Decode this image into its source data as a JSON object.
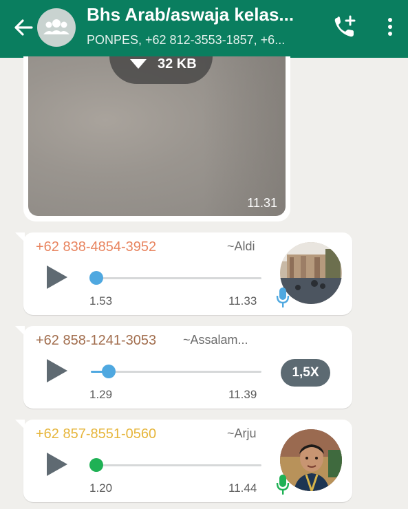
{
  "header": {
    "title": "Bhs Arab/aswaja kelas...",
    "subtitle": "PONPES, +62 812-3553-1857, +6...",
    "bg_color": "#0a7e5f"
  },
  "icons": {
    "back": "arrow-left-icon",
    "group_avatar": "group-icon",
    "add_call": "phone-plus-icon",
    "menu": "more-vertical-icon"
  },
  "image_message": {
    "download_size": "32 KB",
    "time": "11.31"
  },
  "voice_messages": [
    {
      "sender": "+62 838-4854-3952",
      "sender_color": "#e8845f",
      "push_name": "~Aldi",
      "duration": "1.53",
      "time": "11.33",
      "progress": 0.0,
      "knob_color": "#4fa8e0",
      "indicator": "mic-icon",
      "mic_color": "#4fa8e0"
    },
    {
      "sender": "+62 858-1241-3053",
      "sender_color": "#a26e4e",
      "push_name": "~Assalam...",
      "duration": "1.29",
      "time": "11.39",
      "progress": 0.11,
      "knob_color": "#4fa8e0",
      "indicator": "playback-speed",
      "speed": "1,5X"
    },
    {
      "sender": "+62 857-8551-0560",
      "sender_color": "#e6b53a",
      "push_name": "~Arju",
      "duration": "1.20",
      "time": "11.44",
      "progress": 0.0,
      "knob_color": "#1fb155",
      "indicator": "mic-icon",
      "mic_color": "#1fb155"
    }
  ]
}
